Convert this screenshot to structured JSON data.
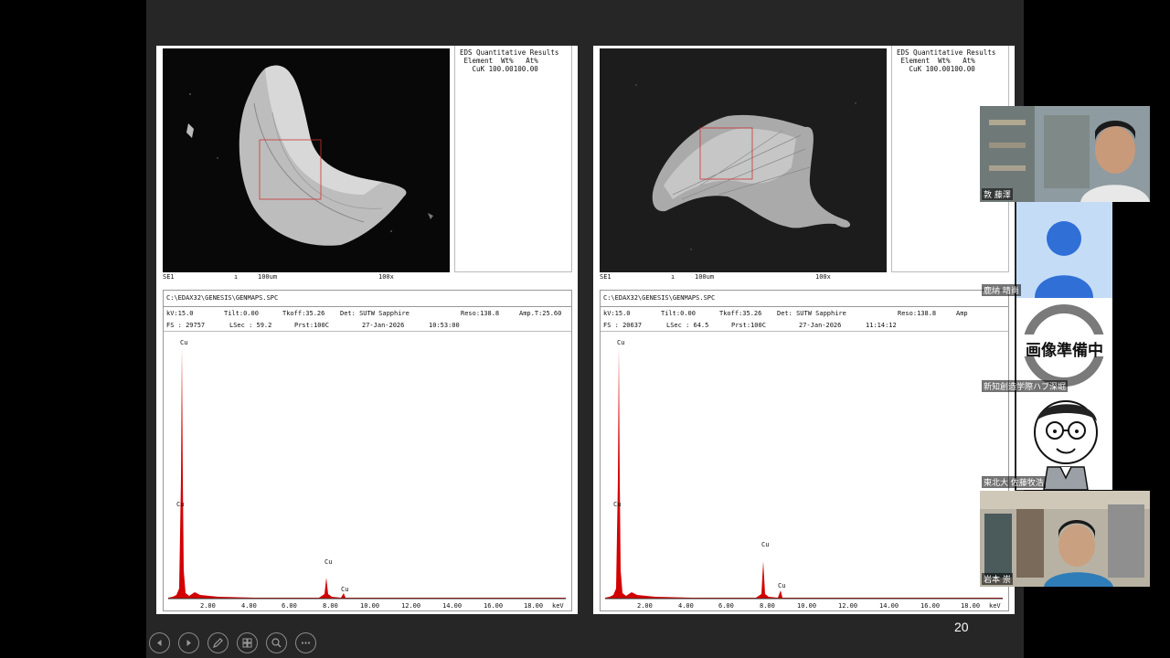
{
  "slide": {
    "page_number": "20"
  },
  "panels": [
    {
      "eds": {
        "title": "EDS Quantitative Results",
        "header": "Element  Wt%   At%",
        "row": "CuK 100.00100.00"
      },
      "sem_footer": {
        "detector": "SE1",
        "scale": "100um",
        "magnification": "100x"
      },
      "spec": {
        "path": "C:\\EDAX32\\GENESIS\\GENMAPS.SPC",
        "kv": "kV:15.0",
        "tilt": "Tilt:0.00",
        "tkoff": "Tkoff:35.26",
        "det": "Det: SUTW Sapphire",
        "reso": "Reso:138.8",
        "amp": "Amp.T:25.60",
        "fs": "FS : 29757",
        "lsec": "LSec : 59.2",
        "prst": "Prst:100C",
        "date": "27-Jan-2026",
        "time": "10:53:00"
      },
      "peak_labels": [
        "Cu",
        "Cu",
        "Cu",
        "Cu"
      ]
    },
    {
      "eds": {
        "title": "EDS Quantitative Results",
        "header": "Element  Wt%   At%",
        "row": "CuK 100.00100.00"
      },
      "sem_footer": {
        "detector": "SE1",
        "scale": "100um",
        "magnification": "100x"
      },
      "spec": {
        "path": "C:\\EDAX32\\GENESIS\\GENMAPS.SPC",
        "kv": "kV:15.0",
        "tilt": "Tilt:0.00",
        "tkoff": "Tkoff:35.26",
        "det": "Det: SUTW Sapphire",
        "reso": "Reso:138.8",
        "amp": "Amp",
        "fs": "FS : 20637",
        "lsec": "LSec : 64.5",
        "prst": "Prst:100C",
        "date": "27-Jan-2026",
        "time": "11:14:12"
      },
      "peak_labels": [
        "Cu",
        "Cu",
        "Cu",
        "Cu"
      ]
    }
  ],
  "axis": {
    "ticks": [
      "2.00",
      "4.00",
      "6.00",
      "8.00",
      "10.00",
      "12.00",
      "14.00",
      "16.00",
      "18.00"
    ],
    "unit": "keV"
  },
  "participants": [
    {
      "name": "敦 藤澤"
    },
    {
      "name": "鹿納 晴尚"
    },
    {
      "name": "新知創造学際ハブ深堀",
      "placeholder": "画像準備中"
    },
    {
      "name": "東北大 佐藤牧浩"
    },
    {
      "name": "岩本 崇"
    }
  ],
  "controls": [
    "prev-icon",
    "next-icon",
    "pen-icon",
    "slides-icon",
    "zoom-icon",
    "more-icon"
  ],
  "colors": {
    "spectrum": "#d40000",
    "background": "#262626",
    "roi": "#cc3333"
  }
}
